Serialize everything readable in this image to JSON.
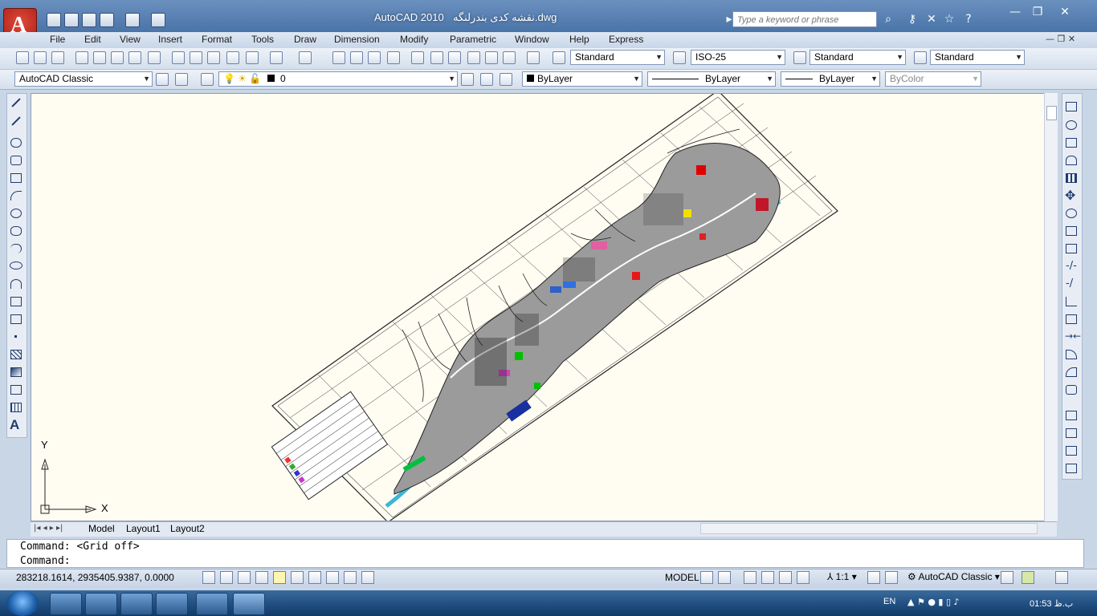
{
  "title_bar": {
    "app_name": "AutoCAD 2010",
    "file_name": "نقشه کدی بندرلنگه.dwg",
    "search_placeholder": "Type a keyword or phrase"
  },
  "menu": [
    "File",
    "Edit",
    "View",
    "Insert",
    "Format",
    "Tools",
    "Draw",
    "Dimension",
    "Modify",
    "Parametric",
    "Window",
    "Help",
    "Express"
  ],
  "styles_toolbar": {
    "text_style": "Standard",
    "dim_style": "ISO-25",
    "table_style": "Standard",
    "multileader_style": "Standard"
  },
  "workspace": "AutoCAD Classic",
  "layers_toolbar": {
    "current_layer": "0",
    "color": "ByLayer",
    "linetype": "ByLayer",
    "lineweight": "ByLayer",
    "plot_style": "ByColor"
  },
  "ucs": {
    "y_label": "Y",
    "x_label": "X"
  },
  "layout_tabs": [
    "Model",
    "Layout1",
    "Layout2"
  ],
  "command_history": [
    "Command:  <Grid off>",
    "Command:"
  ],
  "status": {
    "coordinates": "283218.1614, 2935405.9387, 0.0000",
    "space": "MODEL",
    "annotation_scale": "1:1",
    "workspace": "AutoCAD Classic"
  },
  "taskbar": {
    "language": "EN",
    "clock": "01:53 ب.ظ"
  },
  "colors": {
    "canvas": "#fffdf2",
    "titlebar": "#4a74a8",
    "accent_red": "#d62b1f"
  }
}
